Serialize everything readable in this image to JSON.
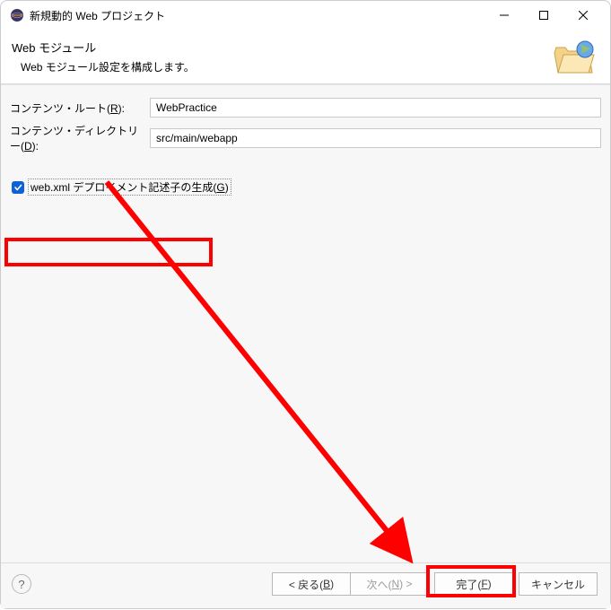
{
  "window": {
    "title": "新規動的 Web プロジェクト"
  },
  "banner": {
    "title": "Web モジュール",
    "subtitle": "Web モジュール設定を構成します。"
  },
  "form": {
    "context_root": {
      "label_pre": "コンテンツ・ルート(",
      "label_mn": "R",
      "label_post": "):",
      "value": "WebPractice"
    },
    "content_dir": {
      "label_pre": "コンテンツ・ディレクトリー(",
      "label_mn": "D",
      "label_post": "):",
      "value": "src/main/webapp"
    }
  },
  "checkbox": {
    "checked": true,
    "label_pre": "web.xml デプロイメント記述子の生成(",
    "label_mn": "G",
    "label_post": ")"
  },
  "footer": {
    "help": "?",
    "back_pre": "< 戻る(",
    "back_mn": "B",
    "back_post": ")",
    "next_pre": "次へ(",
    "next_mn": "N",
    "next_post": ") >",
    "finish_pre": "完了(",
    "finish_mn": "F",
    "finish_post": ")",
    "cancel": "キャンセル"
  }
}
